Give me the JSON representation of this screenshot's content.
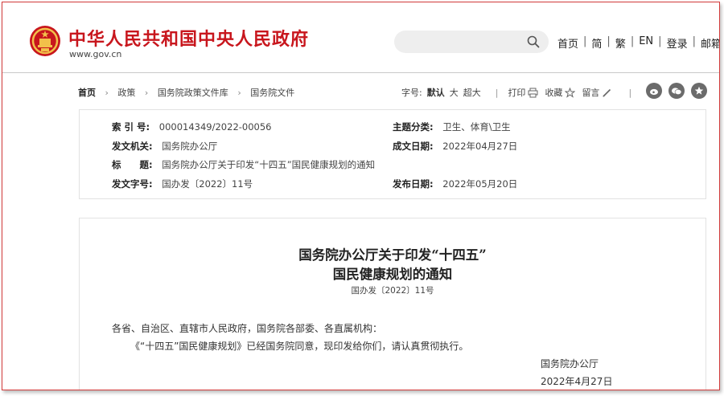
{
  "header": {
    "site_name": "中华人民共和国中央人民政府",
    "site_url": "www.gov.cn",
    "search_placeholder": "",
    "nav": [
      "首页",
      "简",
      "繁",
      "EN",
      "登录",
      "邮箱"
    ]
  },
  "breadcrumb": {
    "items": [
      "首页",
      "政策",
      "国务院政策文件库",
      "国务院文件"
    ]
  },
  "tools": {
    "font_label": "字号:",
    "font_sizes": [
      "默认",
      "大",
      "超大"
    ],
    "print": "打印",
    "favorite": "收藏",
    "comment": "留言"
  },
  "info": {
    "index_label": "索 引 号:",
    "index_value": "000014349/2022-00056",
    "topic_label": "主题分类:",
    "topic_value": "卫生、体育\\卫生",
    "issuer_label": "发文机关:",
    "issuer_value": "国务院办公厅",
    "date_label": "成文日期:",
    "date_value": "2022年04月27日",
    "title_label": "标　　题:",
    "title_value": "国务院办公厅关于印发“十四五”国民健康规划的通知",
    "docnum_label": "发文字号:",
    "docnum_value": "国办发〔2022〕11号",
    "pubdate_label": "发布日期:",
    "pubdate_value": "2022年05月20日"
  },
  "article": {
    "title_line1": "国务院办公厅关于印发“十四五”",
    "title_line2": "国民健康规划的通知",
    "doc_number": "国办发〔2022〕11号",
    "salutation": "各省、自治区、直辖市人民政府，国务院各部委、各直属机构：",
    "body": "《“十四五”国民健康规划》已经国务院同意，现印发给你们，请认真贯彻执行。",
    "signature": "国务院办公厅",
    "sign_date": "2022年4月27日"
  },
  "colors": {
    "brand_red": "#c8161d",
    "border": "#e2e2e2",
    "icon_gray": "#6b6b6b"
  }
}
